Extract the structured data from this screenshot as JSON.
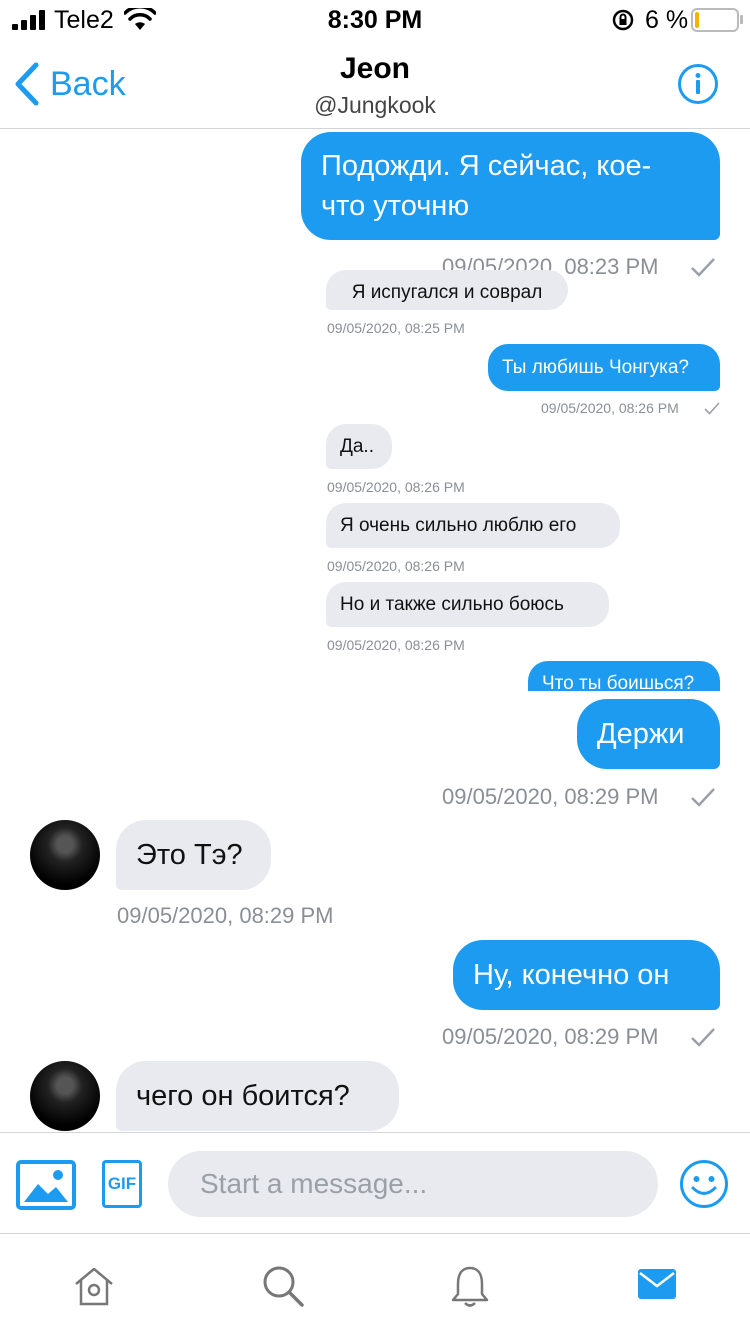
{
  "status_bar": {
    "carrier": "Tele2",
    "time": "8:30 PM",
    "battery_percent": "6 %"
  },
  "header": {
    "back_label": "Back",
    "title": "Jeon",
    "subtitle": "@Jungkook"
  },
  "messages": [
    {
      "side": "out",
      "text": "Подожди. Я сейчас, кое-\nчто уточню",
      "time": "09/05/2020, 08:23 PM"
    },
    {
      "side": "in",
      "text": "Я испугался и соврал",
      "time": "09/05/2020, 08:25 PM"
    },
    {
      "side": "out",
      "text": "Ты любишь Чонгука?",
      "time": "09/05/2020, 08:26 PM"
    },
    {
      "side": "in",
      "text": "Да..",
      "time": "09/05/2020, 08:26 PM"
    },
    {
      "side": "in",
      "text": "Я очень сильно люблю его",
      "time": "09/05/2020, 08:26 PM"
    },
    {
      "side": "in",
      "text": "Но и также сильно боюсь",
      "time": "09/05/2020, 08:26 PM"
    },
    {
      "side": "out",
      "text": "Что ты боишься?",
      "time": ""
    },
    {
      "side": "out",
      "text": "Держи",
      "time": "09/05/2020, 08:29 PM"
    },
    {
      "side": "in",
      "text": "Это Тэ?",
      "time": "09/05/2020, 08:29 PM"
    },
    {
      "side": "out",
      "text": "Ну, конечно он",
      "time": "09/05/2020, 08:29 PM"
    },
    {
      "side": "in",
      "text": "чего он боится?",
      "time": ""
    }
  ],
  "composer": {
    "placeholder": "Start a message...",
    "gif_label": "GIF"
  },
  "icons": {
    "back": "chevron-left-icon",
    "info": "info-icon",
    "image": "image-icon",
    "gif": "gif-icon",
    "emoji": "emoji-icon",
    "home": "home-icon",
    "search": "search-icon",
    "notifications": "bell-icon",
    "messages": "mail-icon"
  },
  "colors": {
    "accent": "#1d9bf0",
    "incoming_bubble": "#e8eaef",
    "timestamp": "#8a8f96"
  }
}
